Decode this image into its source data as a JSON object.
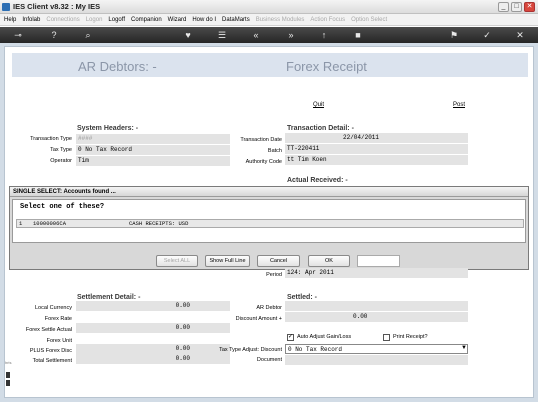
{
  "window": {
    "title": "IES Client v8.32 : My IES",
    "min": "_",
    "max": "□",
    "close": "✕"
  },
  "menu": [
    {
      "label": "Help",
      "enabled": true
    },
    {
      "label": "Infolab",
      "enabled": true
    },
    {
      "label": "Connections",
      "enabled": false
    },
    {
      "label": "Logon",
      "enabled": false
    },
    {
      "label": "Logoff",
      "enabled": true
    },
    {
      "label": "Companion",
      "enabled": true
    },
    {
      "label": "Wizard",
      "enabled": true
    },
    {
      "label": "How do I",
      "enabled": true
    },
    {
      "label": "DataMarts",
      "enabled": true
    },
    {
      "label": "Business Modules",
      "enabled": false
    },
    {
      "label": "Action Focus",
      "enabled": false
    },
    {
      "label": "Option Select",
      "enabled": false
    }
  ],
  "toolbar": {
    "key": "⊸",
    "help": "?",
    "search": "⌕",
    "heart": "♥",
    "menu": "☰",
    "first": "«",
    "prev": "‹",
    "next": "»",
    "up": "↑",
    "stop": "■",
    "fav": "⚑",
    "ok": "✓",
    "close": "✕"
  },
  "banner": {
    "left_title": "AR Debtors: -",
    "right_title": "Forex Receipt"
  },
  "actions": {
    "quit": "Quit",
    "post": "Post"
  },
  "system_headers": {
    "heading": "System Headers: -",
    "transaction_type_label": "Transaction Type",
    "transaction_type_value": "####",
    "tax_type_label": "Tax Type",
    "tax_type_value": "0 No Tax Record",
    "operator_label": "Operator",
    "operator_value": "Tim"
  },
  "transaction_detail": {
    "heading": "Transaction Detail: -",
    "date_label": "Transaction Date",
    "date_value": "22/04/2011",
    "batch_label": "Batch",
    "batch_value": "TT-220411",
    "authority_label": "Authority Code",
    "authority_value": "tt Tim Koen"
  },
  "actual_received": {
    "heading": "Actual Received: -"
  },
  "dialog": {
    "title": "SINGLE SELECT: Accounts found ...",
    "prompt": "Select one of these?",
    "row": {
      "index": "1",
      "account": "10000006CA",
      "description": "CASH RECEIPTS: USD"
    },
    "select_all": "Select ALL",
    "show_full_line": "Show Full Line",
    "cancel": "Cancel",
    "ok": "OK",
    "input_value": ""
  },
  "period": {
    "label": "Period",
    "value": "124: Apr 2011"
  },
  "settlement": {
    "heading": "Settlement Detail: -",
    "local_currency_label": "Local Currency",
    "local_currency_value": "0.00",
    "forex_rate_label": "Forex Rate",
    "forex_rate_value": "",
    "forex_settle_label": "Forex Settle Actual",
    "forex_settle_value": "0.00",
    "forex_unit_label": "Forex Unit",
    "forex_unit_value": "",
    "plus_forex_label": "PLUS Forex Disc",
    "plus_forex_value": "0.00",
    "total_label": "Total Settlement",
    "total_value": "0.00"
  },
  "settled": {
    "heading": "Settled: -",
    "ar_debtor_label": "AR Debtor",
    "ar_debtor_value": "",
    "discount_label": "Discount Amount +",
    "discount_value": "0.00",
    "auto_adjust_label": "Auto Adjust Gain/Loss",
    "auto_adjust_checked": true,
    "print_receipt_label": "Print Receipt?",
    "print_receipt_checked": false,
    "tax_adjust_label": "Tax Type Adjust: Discount",
    "tax_adjust_value": "0 No Tax Record",
    "document_label": "Document",
    "document_value": ""
  },
  "rail": {
    "text": "hris"
  },
  "colors": {
    "banner_bg": "#dbe3ee",
    "page_bg": "#d2dce6",
    "field_bg": "#e3e3e3",
    "toolbar_bg": "#333333"
  }
}
